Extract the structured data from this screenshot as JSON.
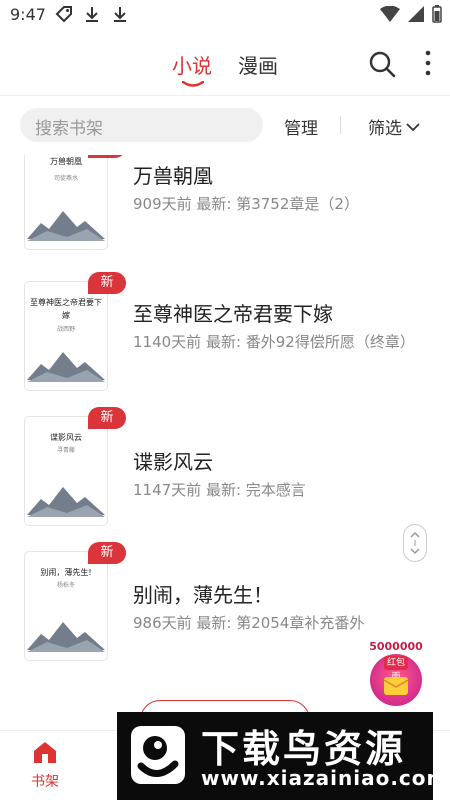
{
  "status_bar": {
    "time": "9:47"
  },
  "header": {
    "tabs": [
      {
        "label": "小说"
      },
      {
        "label": "漫画"
      }
    ]
  },
  "search": {
    "placeholder": "搜索书架"
  },
  "toolbar": {
    "manage_label": "管理",
    "filter_label": "筛选"
  },
  "books": [
    {
      "title": "万兽朝凰",
      "meta": "909天前 最新: 第3752章是（2）",
      "cover_title": "万兽朝凰",
      "cover_author": "司徒燕水",
      "is_new": true
    },
    {
      "title": "至尊神医之帝君要下嫁",
      "meta": "1140天前 最新: 番外92得偿所愿（终章）",
      "cover_title": "至尊神医之帝君要下嫁",
      "cover_author": "战西野",
      "is_new": true
    },
    {
      "title": "谍影风云",
      "meta": "1147天前 最新: 完本感言",
      "cover_title": "谍影风云",
      "cover_author": "寻青藤",
      "is_new": true
    },
    {
      "title": "别闹，薄先生！",
      "meta": "986天前 最新: 第2054章补充番外",
      "cover_title": "别闹，薄先生!",
      "cover_author": "杨栎冬",
      "is_new": true
    }
  ],
  "badge_label": "新",
  "red_packet": {
    "count": "5000000",
    "label": "红包雨"
  },
  "bottom_nav": {
    "shelf_label": "书架"
  },
  "watermark": {
    "text": "下载鸟资源",
    "url": "www.xiazainiao.com"
  },
  "colors": {
    "accent": "#d9353a",
    "text": "#222222",
    "muted": "#888888"
  }
}
